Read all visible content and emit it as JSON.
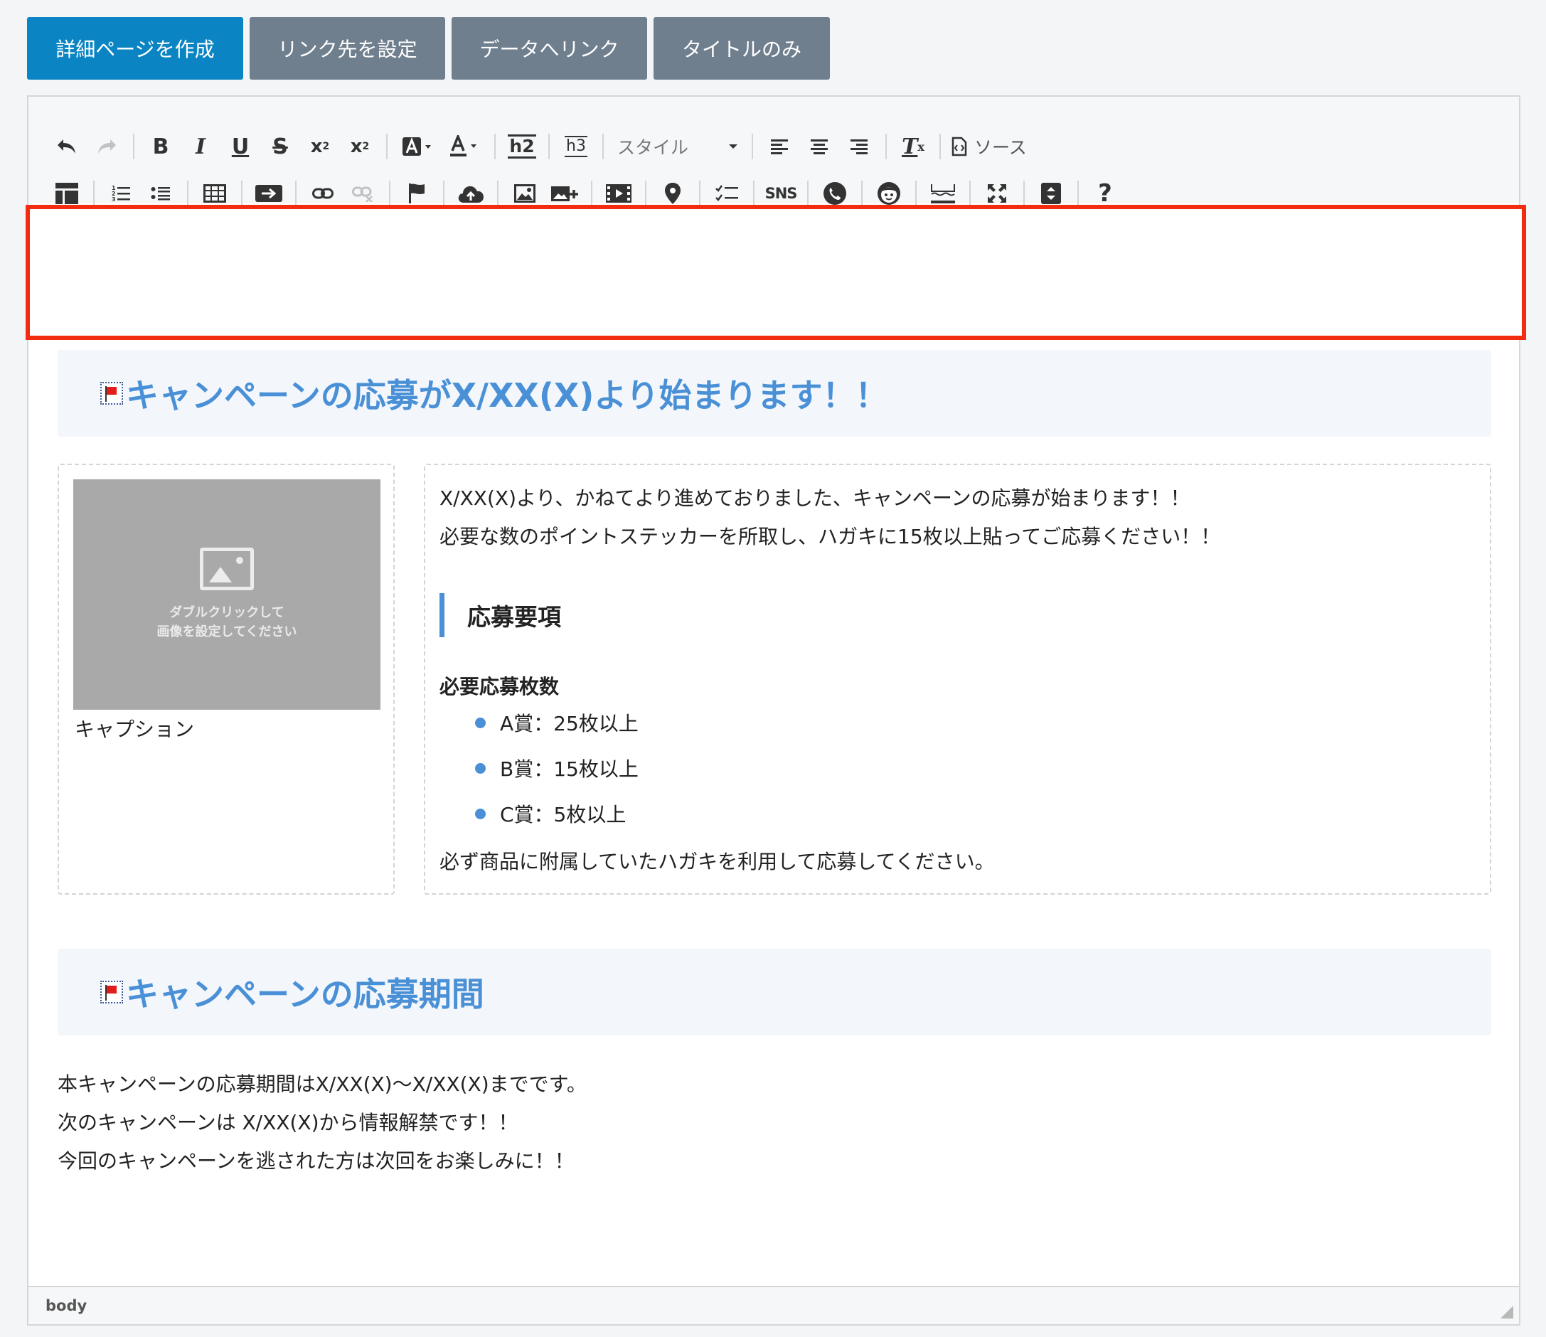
{
  "tabs": [
    {
      "label": "詳細ページを作成",
      "active": true
    },
    {
      "label": "リンク先を設定",
      "active": false
    },
    {
      "label": "データへリンク",
      "active": false
    },
    {
      "label": "タイトルのみ",
      "active": false
    }
  ],
  "toolbar": {
    "style_label": "スタイル",
    "source_label": "ソース",
    "h2_label": "h2",
    "h3_label": "h3",
    "sns_label": "SNS",
    "help_label": "?"
  },
  "content": {
    "heading1": "キャンペーンの応募がX/XX(X)より始まります！！",
    "image_placeholder_line1": "ダブルクリックして",
    "image_placeholder_line2": "画像を設定してください",
    "caption": "キャプション",
    "intro_line1": "X/XX(X)より、かねてより進めておりました、キャンペーンの応募が始まります！！",
    "intro_line2": "必要な数のポイントステッカーを所取し、ハガキに15枚以上貼ってご応募ください！！",
    "subheading": "応募要項",
    "required_label": "必要応募枚数",
    "bullets": [
      "A賞：25枚以上",
      "B賞：15枚以上",
      "C賞：5枚以上"
    ],
    "note": "必ず商品に附属していたハガキを利用して応募してください。",
    "heading2": "キャンペーンの応募期間",
    "period_line1": "本キャンペーンの応募期間はX/XX(X)〜X/XX(X)までです。",
    "period_line2": "次のキャンペーンは X/XX(X)から情報解禁です！！",
    "period_line3": "今回のキャンペーンを逃された方は次回をお楽しみに！！"
  },
  "statusbar": {
    "path": "body"
  },
  "colors": {
    "accent": "#0a84c2",
    "tab_inactive": "#707f8e",
    "heading": "#4a90d6",
    "highlight_border": "#f32c11"
  }
}
